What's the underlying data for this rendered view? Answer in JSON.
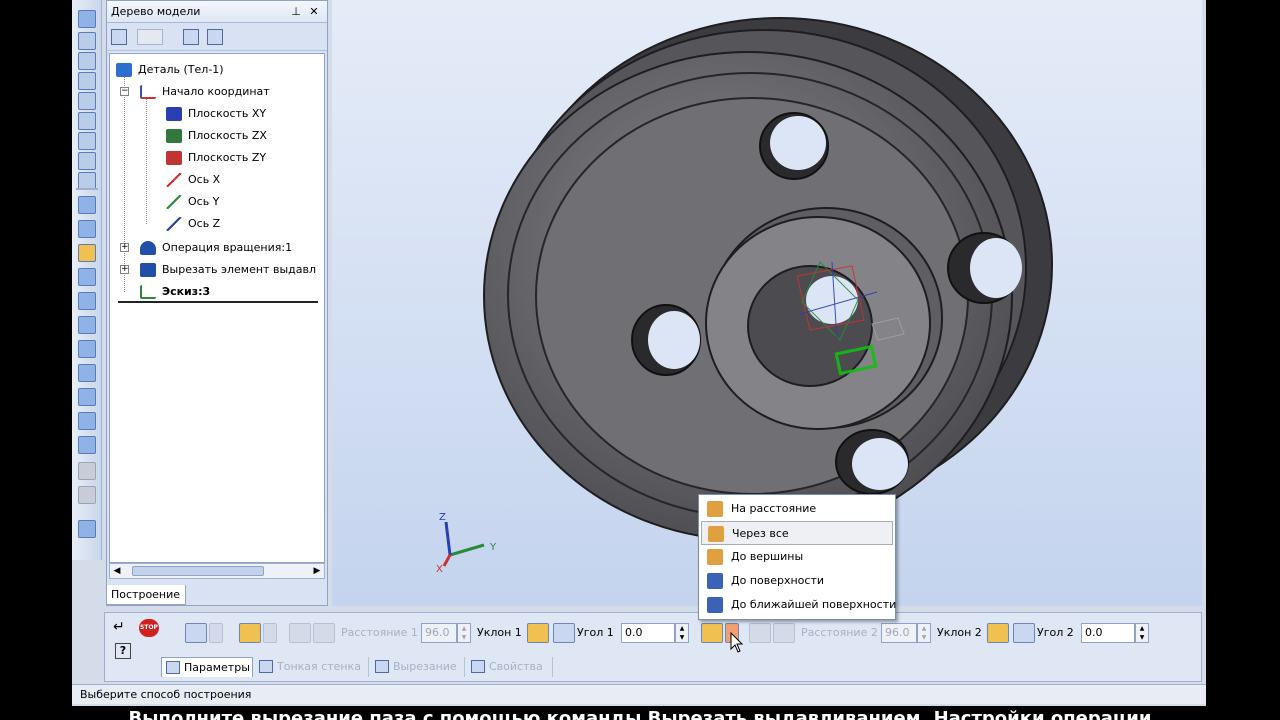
{
  "tree_panel": {
    "title": "Дерево модели",
    "pin_glyph": "⊥",
    "close_glyph": "✕",
    "root": "Деталь (Тел-1)",
    "origin": "Начало координат",
    "planes": [
      "Плоскость XY",
      "Плоскость ZX",
      "Плоскость ZY"
    ],
    "axes": [
      "Ось X",
      "Ось Y",
      "Ось Z"
    ],
    "operations": [
      "Операция вращения:1",
      "Вырезать элемент выдавл"
    ],
    "sketch": "Эскиз:3",
    "tab_label": "Построение"
  },
  "dropdown": {
    "items": [
      "На расстояние",
      "Через все",
      "До вершины",
      "До поверхности",
      "До ближайшей поверхности"
    ],
    "selected": "Через все"
  },
  "property_bar": {
    "distance1_label": "Расстояние 1",
    "distance1_value": "96.0",
    "draft1_label": "Уклон 1",
    "angle1_label": "Угол 1",
    "angle1_value": "0.0",
    "distance2_label": "Расстояние 2",
    "distance2_value": "96.0",
    "draft2_label": "Уклон 2",
    "angle2_label": "Угол 2",
    "angle2_value": "0.0",
    "tabs": [
      "Параметры",
      "Тонкая стенка",
      "Вырезание",
      "Свойства"
    ],
    "stop_label": "STOP"
  },
  "status": "Выберите способ построения",
  "triad": {
    "x": "X",
    "y": "Y",
    "z": "Z"
  },
  "caption": "Выполните вырезание паза с помощью команды Вырезать выдавливанием. Настройки операции",
  "colors": {
    "accent": "#3a63b8",
    "selected_menu_bg": "#eef0f4",
    "highlight_orange": "#f0c050",
    "viewport_top": "#e5ecf8",
    "viewport_bottom": "#c4d4ee"
  }
}
